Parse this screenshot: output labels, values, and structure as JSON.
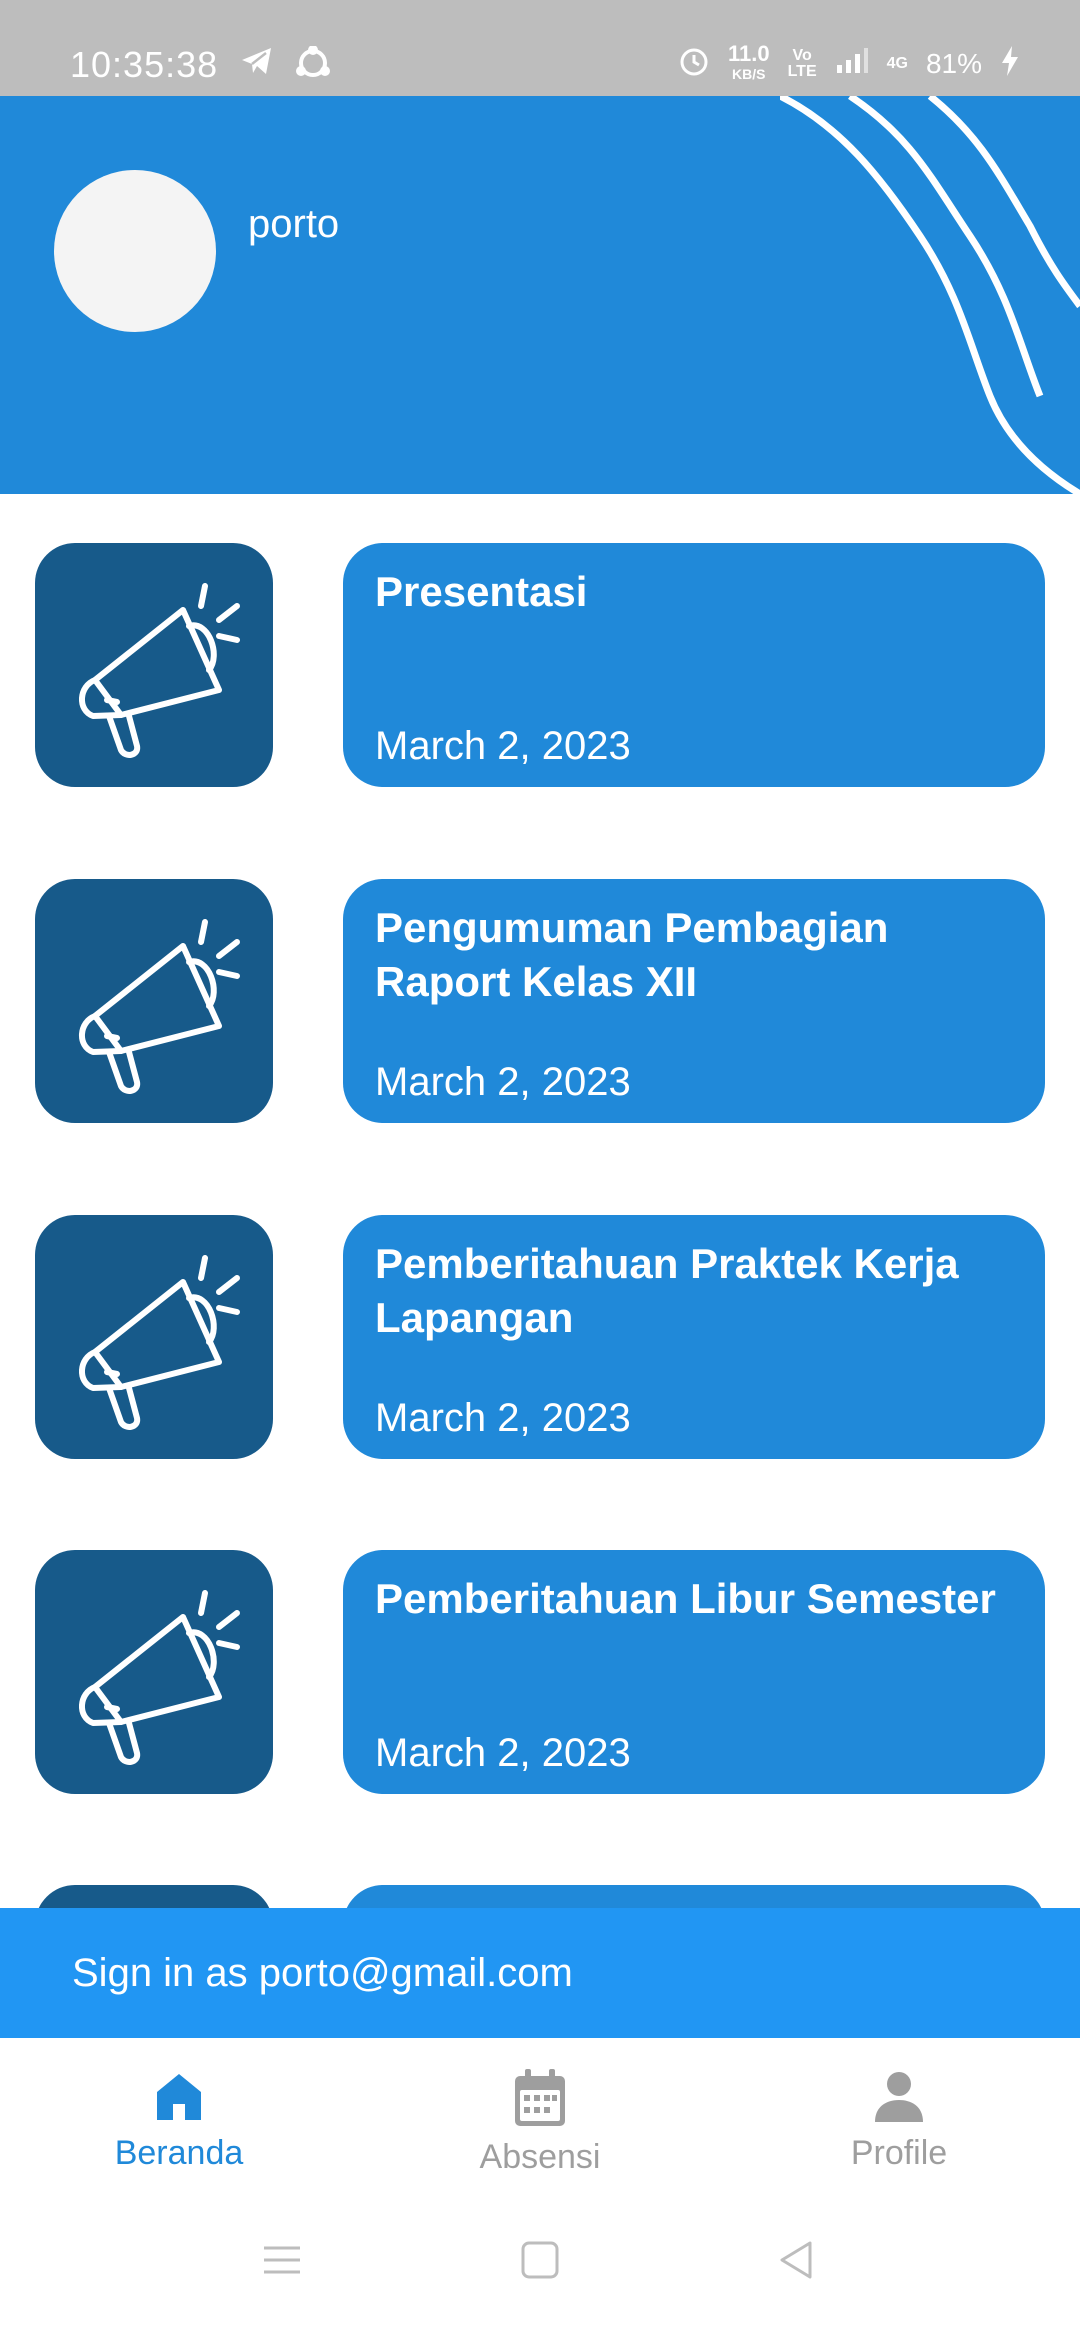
{
  "status_bar": {
    "time": "10:35:38",
    "speed_value": "11.0",
    "speed_unit": "KB/S",
    "volte_top": "Vo",
    "volte_bottom": "LTE",
    "network": "4G",
    "battery": "81%",
    "icons": [
      "telegram-icon",
      "sync-icon",
      "alarm-icon",
      "signal-icon",
      "battery-charging-icon"
    ]
  },
  "header": {
    "username": "porto"
  },
  "announcements": [
    {
      "title": "Presentasi",
      "date": "March 2, 2023",
      "icon": "megaphone-icon"
    },
    {
      "title": "Pengumuman Pembagian Raport Kelas XII",
      "date": "March 2, 2023",
      "icon": "megaphone-icon"
    },
    {
      "title": "Pemberitahuan Praktek Kerja Lapangan",
      "date": "March 2, 2023",
      "icon": "megaphone-icon"
    },
    {
      "title": "Pemberitahuan Libur Semester",
      "date": "March 2, 2023",
      "icon": "megaphone-icon"
    }
  ],
  "signin": {
    "text": "Sign in as porto@gmail.com"
  },
  "bottom_nav": {
    "items": [
      {
        "label": "Beranda",
        "icon": "home-icon",
        "active": true
      },
      {
        "label": "Absensi",
        "icon": "calendar-icon",
        "active": false
      },
      {
        "label": "Profile",
        "icon": "person-icon",
        "active": false
      }
    ]
  },
  "colors": {
    "primary": "#2089d9",
    "icon_box": "#175a8a",
    "signin_bar": "#2196f3",
    "status_bar": "#bdbdbd",
    "inactive": "#9e9e9e"
  }
}
